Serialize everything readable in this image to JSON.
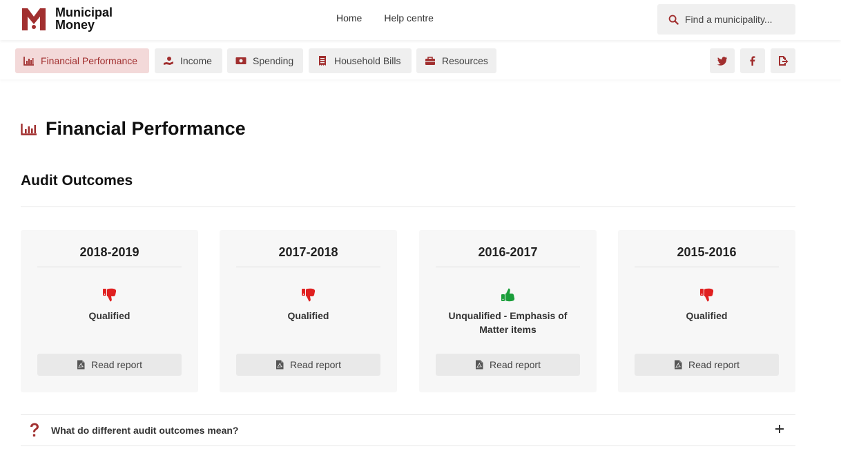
{
  "brand": {
    "line1": "Municipal",
    "line2": "Money",
    "accent": "#a12f2f"
  },
  "topnav": {
    "links": [
      "Home",
      "Help centre"
    ]
  },
  "search": {
    "placeholder": "Find a municipality...",
    "icon": "search-icon"
  },
  "tabs": [
    {
      "label": "Financial Performance",
      "icon": "chart-bar-icon",
      "active": true
    },
    {
      "label": "Income",
      "icon": "hand-coin-icon",
      "active": false
    },
    {
      "label": "Spending",
      "icon": "money-bill-icon",
      "active": false
    },
    {
      "label": "Household Bills",
      "icon": "receipt-icon",
      "active": false
    },
    {
      "label": "Resources",
      "icon": "toolbox-icon",
      "active": false
    }
  ],
  "share": [
    "twitter-icon",
    "facebook-icon",
    "share-icon"
  ],
  "page": {
    "title": "Financial Performance",
    "section": "Audit Outcomes"
  },
  "audits": [
    {
      "year": "2018-2019",
      "outcome": "Qualified",
      "good": false,
      "report": "Read report"
    },
    {
      "year": "2017-2018",
      "outcome": "Qualified",
      "good": false,
      "report": "Read report"
    },
    {
      "year": "2016-2017",
      "outcome": "Unqualified - Emphasis of Matter items",
      "good": true,
      "report": "Read report"
    },
    {
      "year": "2015-2016",
      "outcome": "Qualified",
      "good": false,
      "report": "Read report"
    }
  ],
  "faq": {
    "question": "What do different audit outcomes mean?"
  },
  "colors": {
    "bad": "#e02020",
    "good": "#1a9e3a",
    "activeTabBg": "#f3d9d9"
  }
}
